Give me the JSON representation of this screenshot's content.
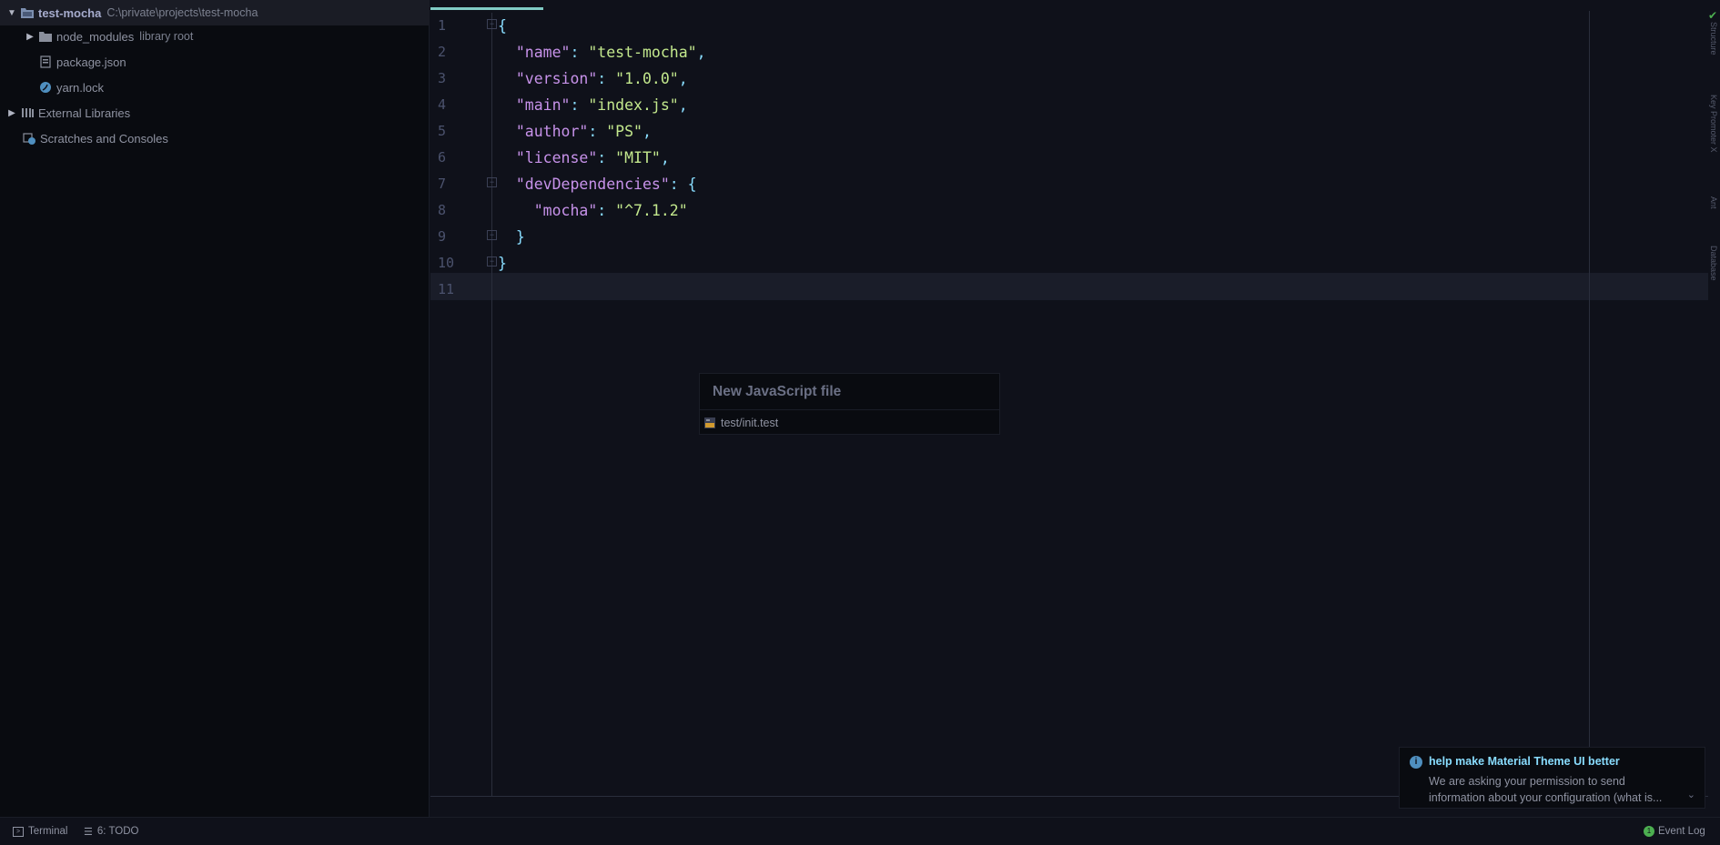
{
  "project_tree": {
    "root": {
      "name": "test-mocha",
      "path": "C:\\private\\projects\\test-mocha"
    },
    "node_modules": {
      "name": "node_modules",
      "hint": "library root"
    },
    "package_json": {
      "name": "package.json"
    },
    "yarn_lock": {
      "name": "yarn.lock"
    },
    "external_libraries": {
      "name": "External Libraries"
    },
    "scratches": {
      "name": "Scratches and Consoles"
    }
  },
  "editor": {
    "line_numbers": [
      "1",
      "2",
      "3",
      "4",
      "5",
      "6",
      "7",
      "8",
      "9",
      "10",
      "11"
    ],
    "code": {
      "l1_brace": "{",
      "name_key": "\"name\"",
      "name_val": "\"test-mocha\"",
      "version_key": "\"version\"",
      "version_val": "\"1.0.0\"",
      "main_key": "\"main\"",
      "main_val": "\"index.js\"",
      "author_key": "\"author\"",
      "author_val": "\"PS\"",
      "license_key": "\"license\"",
      "license_val": "\"MIT\"",
      "devdeps_key": "\"devDependencies\"",
      "mocha_key": "\"mocha\"",
      "mocha_val": "\"^7.1.2\"",
      "close_inner": "}",
      "close_outer": "}"
    }
  },
  "popup": {
    "title": "New JavaScript file",
    "item": "test/init.test"
  },
  "notification": {
    "title": "help make Material Theme UI better",
    "body": "We are asking your permission to send information about your configuration (what is..."
  },
  "right_strip": {
    "labels": [
      "Structure",
      "Key Promoter X",
      "Ant",
      "Database"
    ]
  },
  "statusbar": {
    "terminal": "Terminal",
    "todo": "6: TODO",
    "event_log": "Event Log",
    "event_count": "1"
  },
  "colors": {
    "background": "#0f111a",
    "sidebar": "#090b10",
    "accent": "#80cbc4",
    "key": "#c792ea",
    "string": "#c3e88d",
    "punctuation": "#89ddff"
  }
}
